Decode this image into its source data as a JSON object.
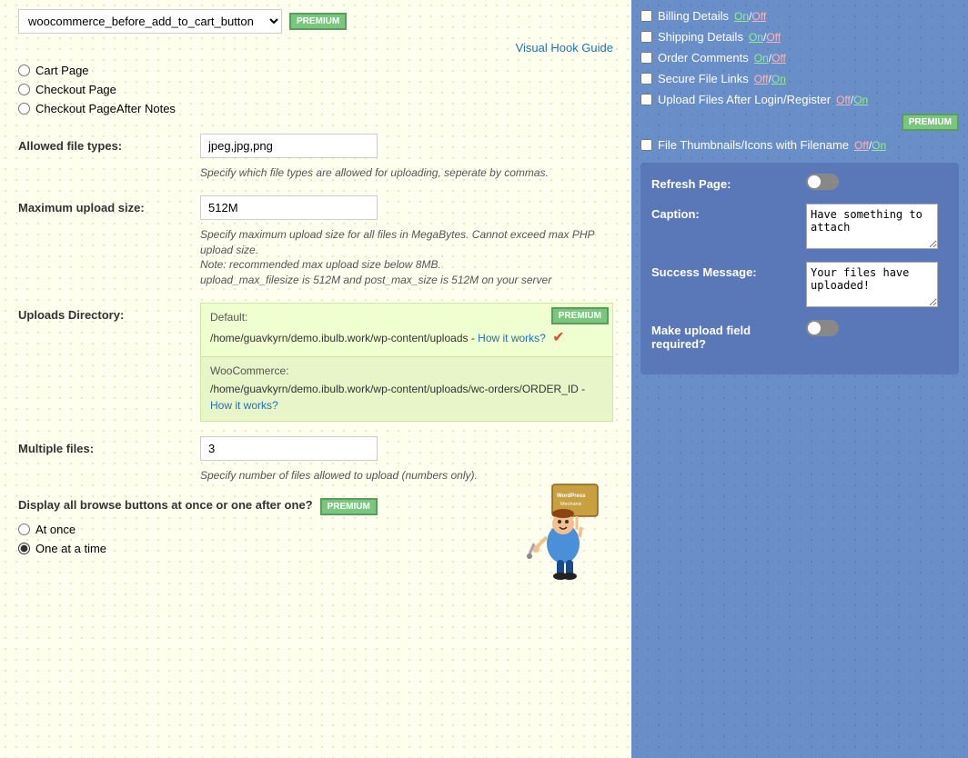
{
  "left": {
    "hook_select_value": "woocommerce_before_add_to_cart_button",
    "visual_hook_link": "Visual Hook Guide",
    "radio_options": [
      {
        "label": "Cart Page",
        "value": "cart",
        "checked": false
      },
      {
        "label": "Checkout Page",
        "value": "checkout",
        "checked": false
      },
      {
        "label": "Checkout PageAfter Notes",
        "value": "checkout_after",
        "checked": false
      }
    ],
    "file_types_label": "Allowed file types:",
    "file_types_value": "jpeg,jpg,png",
    "file_types_hint": "Specify which file types are allowed for uploading, seperate by commas.",
    "max_upload_label": "Maximum upload size:",
    "max_upload_value": "512M",
    "max_upload_hint": "Specify maximum upload size for all files in MegaBytes. Cannot exceed max PHP upload size.",
    "max_upload_note": "Note: recommended max upload size below 8MB.",
    "max_upload_server": "upload_max_filesize is 512M and post_max_size is 512M on your server",
    "uploads_dir_label": "Uploads Directory:",
    "uploads_default_label": "Default:",
    "uploads_default_path": "/home/guavkyrn/demo.ibulb.work/wp-content/uploads",
    "uploads_default_link": "How it works?",
    "uploads_woo_label": "WooCommerce:",
    "uploads_woo_path": "/home/guavkyrn/demo.ibulb.work/wp-content/uploads/wc-orders/ORDER_ID",
    "uploads_woo_link": "How it works?",
    "multiple_files_label": "Multiple files:",
    "multiple_files_value": "3",
    "multiple_files_hint": "Specify number of files allowed to upload (numbers only).",
    "browse_question": "Display all browse buttons at once or one after one?",
    "browse_at_once": "At once",
    "browse_one_at_a_time": "One at a time",
    "browse_one_checked": true
  },
  "right": {
    "billing_details": "Billing Details",
    "billing_on": "On",
    "billing_off": "Off",
    "shipping_details": "Shipping Details",
    "shipping_on": "On",
    "shipping_off": "Off",
    "order_comments": "Order Comments",
    "order_on": "On",
    "order_off": "Off",
    "secure_file_links": "Secure File Links",
    "secure_off": "Off",
    "secure_on": "On",
    "upload_after_login": "Upload Files After Login/Register",
    "upload_off": "Off",
    "upload_on": "On",
    "file_thumbnails": "File Thumbnails/Icons with Filename",
    "thumbnails_off": "Off",
    "thumbnails_on": "On",
    "refresh_page_label": "Refresh Page:",
    "caption_label": "Caption:",
    "caption_value": "Have something to attach",
    "success_message_label": "Success Message:",
    "success_message_value": "Your files have uploaded!",
    "make_required_label": "Make upload field required?",
    "premium_label": "PREMIUM"
  },
  "icons": {
    "checkmark": "✔",
    "premium": "PREMIUM"
  }
}
